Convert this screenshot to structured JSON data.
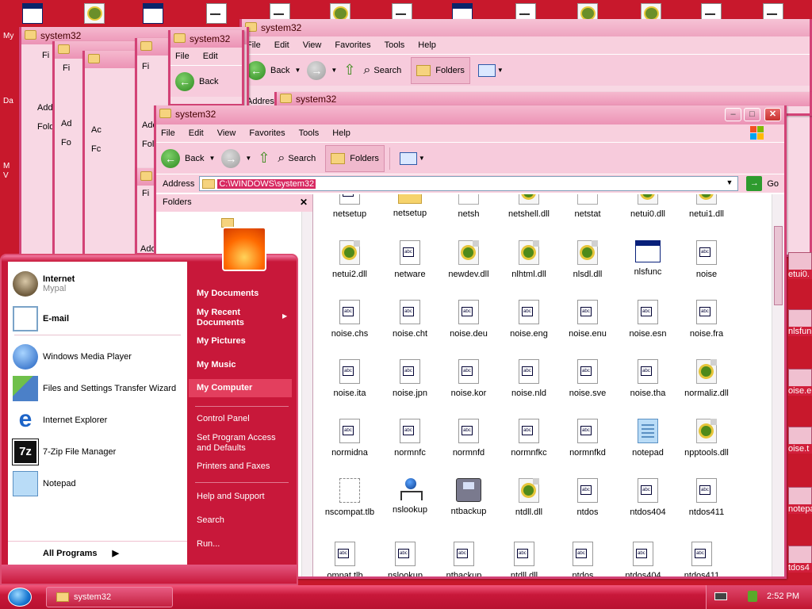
{
  "desktop": {
    "left_labels": [
      "My",
      "Da",
      "M",
      "V"
    ],
    "icons": [
      "library-icon",
      "library-icon",
      "program-icon",
      "document-icon",
      "document-icon",
      "library-icon",
      "document-icon",
      "program-icon",
      "document-icon",
      "library-icon",
      "library-icon",
      "document-icon",
      "document-icon"
    ]
  },
  "window_back": {
    "title": "system32",
    "menu": [
      "File",
      "Edit",
      "View",
      "Favorites",
      "Tools",
      "Help"
    ],
    "toolbar": {
      "back": "Back",
      "search": "Search",
      "folders": "Folders"
    },
    "address_label": "Addres",
    "inner_title": "system32"
  },
  "stacked_windows": {
    "title": "system32",
    "menu": [
      "File",
      "Edit"
    ],
    "back": "Back",
    "fragments": [
      "Fi",
      "Add",
      "Fold",
      "Ad",
      "Fo",
      "Ac",
      "Fc",
      "Add",
      "Fol",
      "Fi",
      "Ad",
      "Fi",
      "Ado"
    ]
  },
  "main_window": {
    "title": "system32",
    "menu": [
      "File",
      "Edit",
      "View",
      "Favorites",
      "Tools",
      "Help"
    ],
    "toolbar": {
      "back": "Back",
      "search": "Search",
      "folders": "Folders"
    },
    "address_label": "Address",
    "address_value": "C:\\WINDOWS\\system32",
    "go": "Go",
    "folders_pane_title": "Folders",
    "files": [
      {
        "name": "netsetup",
        "icon": "document-icon"
      },
      {
        "name": "netsetup",
        "icon": "folder-icon"
      },
      {
        "name": "netsh",
        "icon": "generic-file-icon"
      },
      {
        "name": "netshell.dll",
        "icon": "dll-icon"
      },
      {
        "name": "netstat",
        "icon": "generic-file-icon"
      },
      {
        "name": "netui0.dll",
        "icon": "dll-icon"
      },
      {
        "name": "netui1.dll",
        "icon": "dll-icon"
      },
      {
        "name": "netui2.dll",
        "icon": "dll-icon"
      },
      {
        "name": "netware",
        "icon": "document-icon"
      },
      {
        "name": "newdev.dll",
        "icon": "dll-icon"
      },
      {
        "name": "nlhtml.dll",
        "icon": "dll-icon"
      },
      {
        "name": "nlsdl.dll",
        "icon": "dll-icon"
      },
      {
        "name": "nlsfunc",
        "icon": "program-icon"
      },
      {
        "name": "noise",
        "icon": "document-icon"
      },
      {
        "name": "noise.chs",
        "icon": "document-icon"
      },
      {
        "name": "noise.cht",
        "icon": "document-icon"
      },
      {
        "name": "noise.deu",
        "icon": "document-icon"
      },
      {
        "name": "noise.eng",
        "icon": "document-icon"
      },
      {
        "name": "noise.enu",
        "icon": "document-icon"
      },
      {
        "name": "noise.esn",
        "icon": "document-icon"
      },
      {
        "name": "noise.fra",
        "icon": "document-icon"
      },
      {
        "name": "noise.ita",
        "icon": "document-icon"
      },
      {
        "name": "noise.jpn",
        "icon": "document-icon"
      },
      {
        "name": "noise.kor",
        "icon": "document-icon"
      },
      {
        "name": "noise.nld",
        "icon": "document-icon"
      },
      {
        "name": "noise.sve",
        "icon": "document-icon"
      },
      {
        "name": "noise.tha",
        "icon": "document-icon"
      },
      {
        "name": "normaliz.dll",
        "icon": "dll-icon"
      },
      {
        "name": "normidna",
        "icon": "document-icon"
      },
      {
        "name": "normnfc",
        "icon": "document-icon"
      },
      {
        "name": "normnfd",
        "icon": "document-icon"
      },
      {
        "name": "normnfkc",
        "icon": "document-icon"
      },
      {
        "name": "normnfkd",
        "icon": "document-icon"
      },
      {
        "name": "notepad",
        "icon": "notepad-icon"
      },
      {
        "name": "npptools.dll",
        "icon": "dll-icon"
      },
      {
        "name": "nscompat.tlb",
        "icon": "compat-icon"
      },
      {
        "name": "nslookup",
        "icon": "network-icon"
      },
      {
        "name": "ntbackup",
        "icon": "backup-icon"
      },
      {
        "name": "ntdll.dll",
        "icon": "dll-icon"
      },
      {
        "name": "ntdos",
        "icon": "document-icon"
      },
      {
        "name": "ntdos404",
        "icon": "document-icon"
      },
      {
        "name": "ntdos411",
        "icon": "document-icon"
      }
    ],
    "ghost_row": [
      "ompat.tlb",
      "nslookup",
      "ntbackup",
      "ntdll.dll",
      "ntdos",
      "ntdos404",
      "ntdos411"
    ]
  },
  "right_edge_labels": [
    "etui0.",
    "nlsfun",
    "oise.e",
    "oise.t",
    "notepa",
    "tdos4"
  ],
  "start_menu": {
    "pinned": [
      {
        "label": "Internet",
        "sub": "Mypal",
        "icon": "browser-icon"
      },
      {
        "label": "E-mail",
        "icon": "mail-icon"
      }
    ],
    "recent": [
      {
        "label": "Windows Media Player",
        "icon": "media-player-icon"
      },
      {
        "label": "Files and Settings Transfer Wizard",
        "icon": "transfer-wizard-icon"
      },
      {
        "label": "Internet Explorer",
        "icon": "internet-explorer-icon"
      },
      {
        "label": "7-Zip File Manager",
        "icon": "7zip-icon"
      },
      {
        "label": "Notepad",
        "icon": "notepad-icon"
      }
    ],
    "all_programs": "All Programs",
    "right": [
      {
        "label": "My Documents"
      },
      {
        "label": "My Recent Documents"
      },
      {
        "label": "My Pictures"
      },
      {
        "label": "My Music"
      },
      {
        "label": "My Computer"
      },
      {
        "label": "Control Panel"
      },
      {
        "label": "Set Program Access and Defaults"
      },
      {
        "label": "Printers and Faxes"
      },
      {
        "label": "Help and Support"
      },
      {
        "label": "Search"
      },
      {
        "label": "Run..."
      }
    ]
  },
  "taskbar": {
    "task_label": "system32",
    "clock": "2:52 PM"
  },
  "colors": {
    "accent": "#c8182c",
    "window_border": "#d34276",
    "selection": "#d82a62"
  }
}
